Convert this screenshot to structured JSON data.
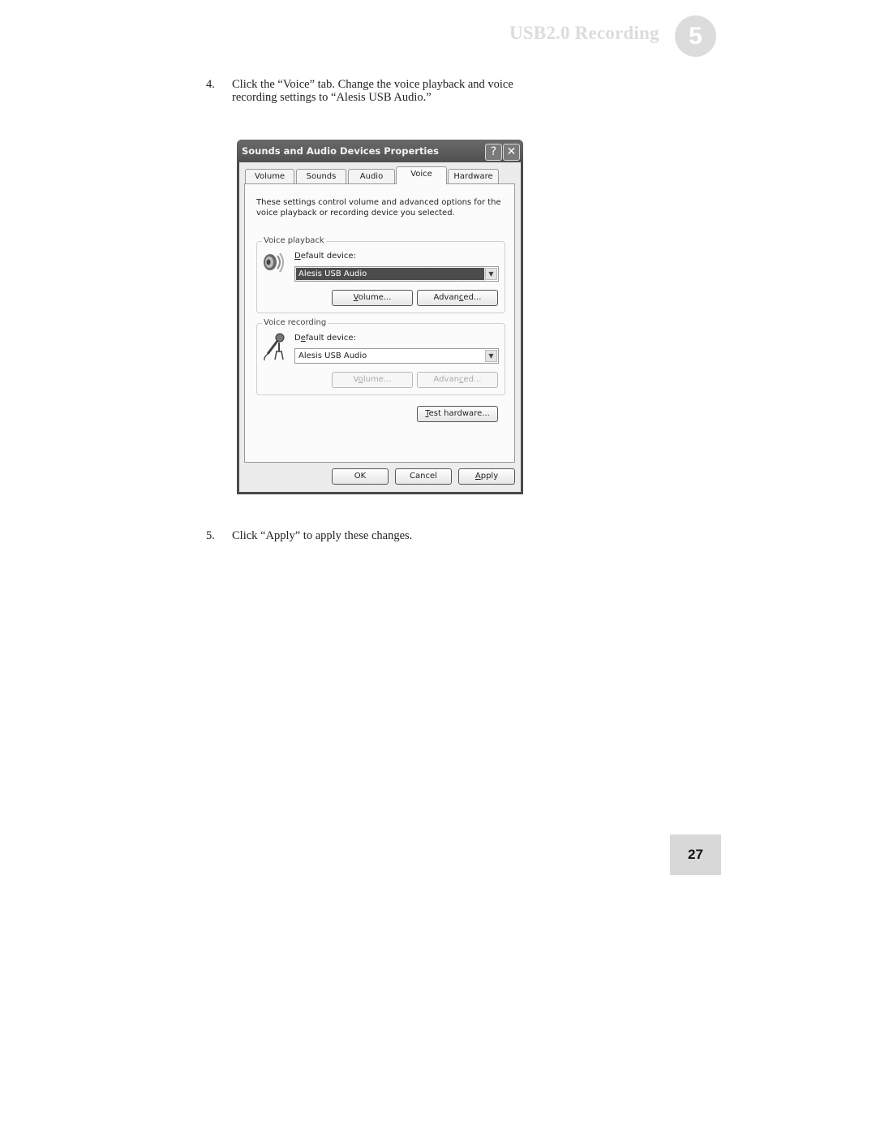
{
  "header": {
    "section_title": "USB2.0 Recording",
    "chapter_number": "5"
  },
  "steps": [
    {
      "number": "4.",
      "text": "Click the “Voice” tab.  Change the voice playback and voice recording settings to “Alesis USB Audio.”"
    },
    {
      "number": "5.",
      "text": "Click “Apply” to apply these changes."
    }
  ],
  "dialog": {
    "title": "Sounds and Audio Devices Properties",
    "help_icon": "?",
    "close_icon": "✕",
    "tabs": [
      {
        "label": "Volume",
        "active": false
      },
      {
        "label": "Sounds",
        "active": false
      },
      {
        "label": "Audio",
        "active": false
      },
      {
        "label": "Voice",
        "active": true
      },
      {
        "label": "Hardware",
        "active": false
      }
    ],
    "description": "These settings control volume and advanced options for the voice playback or recording device you selected.",
    "voice_playback": {
      "group_label": "Voice playback",
      "icon": "speaker-icon",
      "device_label": "Default device:",
      "device_value": "Alesis USB Audio",
      "volume_button": "Volume...",
      "advanced_button": "Advanced...",
      "buttons_enabled": true
    },
    "voice_recording": {
      "group_label": "Voice recording",
      "icon": "microphone-icon",
      "device_label": "Default device:",
      "device_value": "Alesis USB Audio",
      "volume_button": "Volume...",
      "advanced_button": "Advanced...",
      "buttons_enabled": false
    },
    "test_hardware_button": "Test hardware...",
    "ok_button": "OK",
    "cancel_button": "Cancel",
    "apply_button": "Apply"
  },
  "footer": {
    "page_number": "27"
  }
}
